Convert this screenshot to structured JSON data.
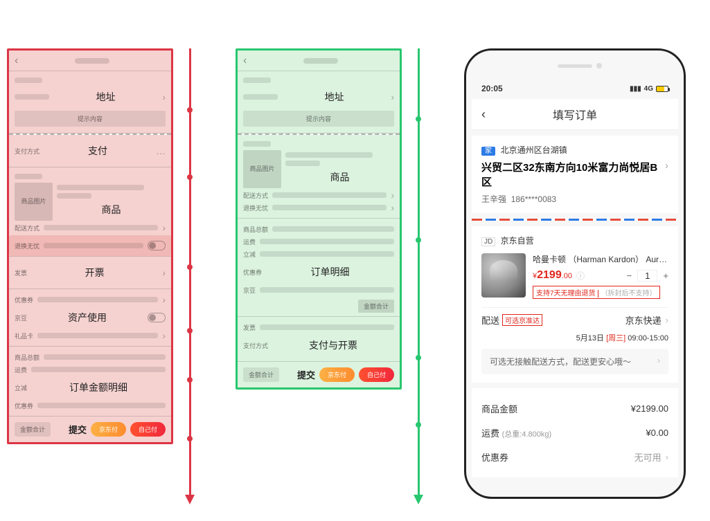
{
  "wireframe_red": {
    "sections": {
      "address": "地址",
      "hint": "提示内容",
      "payment": "支付",
      "product": "商品",
      "invoice": "开票",
      "assets": "资产使用",
      "order_amount": "订单金额明细",
      "submit": "提交"
    },
    "labels": {
      "pay_method": "支付方式",
      "product_img": "商品图片",
      "delivery_method": "配送方式",
      "return_free": "退换无忧",
      "invoice_lbl": "发票",
      "coupon": "优惠券",
      "jingdou": "京豆",
      "gift_card": "礼品卡",
      "product_total": "商品总额",
      "shipping": "运费",
      "discount": "立减",
      "coupon2": "优惠券",
      "total": "金额合计",
      "pay_btn": "京东付",
      "self_pay_btn": "自己付"
    }
  },
  "wireframe_green": {
    "sections": {
      "address": "地址",
      "hint": "提示内容",
      "product": "商品",
      "order_detail": "订单明细",
      "pay_invoice": "支付与开票",
      "submit": "提交"
    },
    "labels": {
      "product_img": "商品图片",
      "delivery_method": "配送方式",
      "return_free": "退换无忧",
      "product_total": "商品总额",
      "shipping": "运费",
      "discount": "立减",
      "coupon": "优惠券",
      "jingdou": "京豆",
      "total_sub": "金额合计",
      "invoice_lbl": "发票",
      "pay_method": "支付方式",
      "total": "金额合计",
      "pay_btn": "京东付",
      "self_pay_btn": "自己付"
    }
  },
  "phone": {
    "status": {
      "time": "20:05",
      "network": "4G"
    },
    "nav_title": "填写订单",
    "address": {
      "tag": "家",
      "district": "北京通州区台湖镇",
      "main": "兴贸二区32东南方向10米富力尚悦居B区",
      "name": "王辛强",
      "phone": "186****0083"
    },
    "store": {
      "jd_tag": "JD",
      "store_name": "京东自营",
      "product_name": "哈曼卡顿 （Harman Kardon） Aura St...",
      "price_symbol": "¥",
      "price_main": "2199",
      "price_decimal": ".00",
      "qty": "1",
      "return_policy": "支持7天无理由退货",
      "return_note": "（拆封后不支持）"
    },
    "delivery": {
      "label": "配送",
      "tag": "可选京准达",
      "express": "京东快递",
      "date": "5月13日",
      "weekday": "[周三]",
      "time_range": "09:00-15:00"
    },
    "banner": "可选无接触配送方式，配送更安心哦～",
    "summary": {
      "product_amount_label": "商品金额",
      "product_amount_value": "¥2199.00",
      "shipping_label": "运费",
      "shipping_weight": "(总重:4.800kg)",
      "shipping_value": "¥0.00",
      "coupon_label": "优惠券",
      "coupon_value": "无可用"
    }
  }
}
